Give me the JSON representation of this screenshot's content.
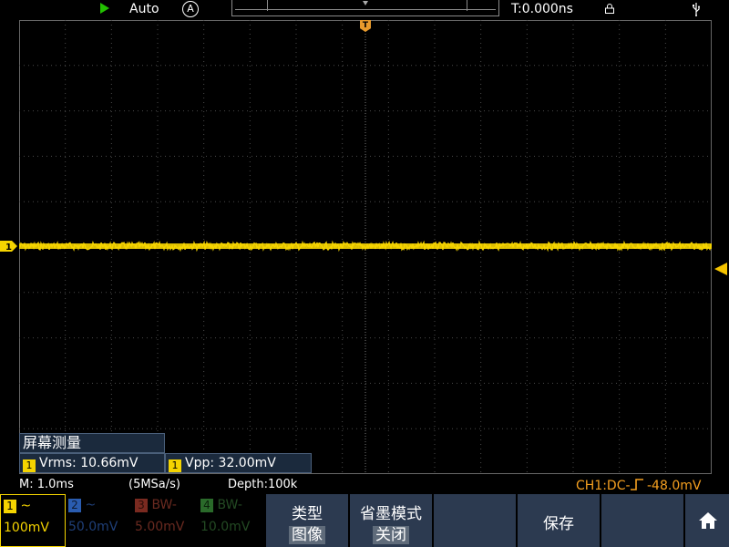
{
  "top_bar": {
    "run_mode": "Auto",
    "trigger_mode_icon": "A",
    "time_offset": "T:0.000ns"
  },
  "icons": {
    "run": "play-triangle-icon",
    "trigger_mode": "circled-a-icon",
    "lock": "lock-icon",
    "usb": "usb-icon",
    "home": "home-icon",
    "trigger_marker": "trigger-position-marker",
    "ch1_marker": "ch1-ground-marker",
    "trigger_level": "trigger-level-arrow"
  },
  "markers": {
    "trigger_label": "T",
    "ch1_label": "1"
  },
  "measure": {
    "title": "屏幕测量",
    "items": [
      {
        "channel": "1",
        "label": "Vrms:",
        "value": "10.66mV"
      },
      {
        "channel": "1",
        "label": "Vpp:",
        "value": "32.00mV"
      }
    ]
  },
  "status": {
    "timebase": "M: 1.0ms",
    "sample_rate": "(5MSa/s)",
    "depth": "Depth:100k",
    "trigger_info": "CH1:DC-",
    "trigger_level": "-48.0mV"
  },
  "channels": [
    {
      "num": "1",
      "coupling": "~",
      "scale": "100mV",
      "color": "#f5d400",
      "active": true
    },
    {
      "num": "2",
      "coupling": "~",
      "scale": "50.0mV",
      "color": "#2a6fd6",
      "active": false
    },
    {
      "num": "3",
      "coupling": "BW-",
      "scale": "5.00mV",
      "color": "#c43a2a",
      "active": false
    },
    {
      "num": "4",
      "coupling": "BW-",
      "scale": "10.0mV",
      "color": "#2f9a3a",
      "active": false
    }
  ],
  "menu": {
    "type_label": "类型",
    "type_value": "图像",
    "ink_label": "省墨模式",
    "ink_value": "关闭",
    "save_label": "保存"
  },
  "colors": {
    "trace": "#f5d400",
    "trigger": "#e89a2c",
    "menu_bg": "#2c3a50",
    "grid": "#4a4a4a"
  }
}
